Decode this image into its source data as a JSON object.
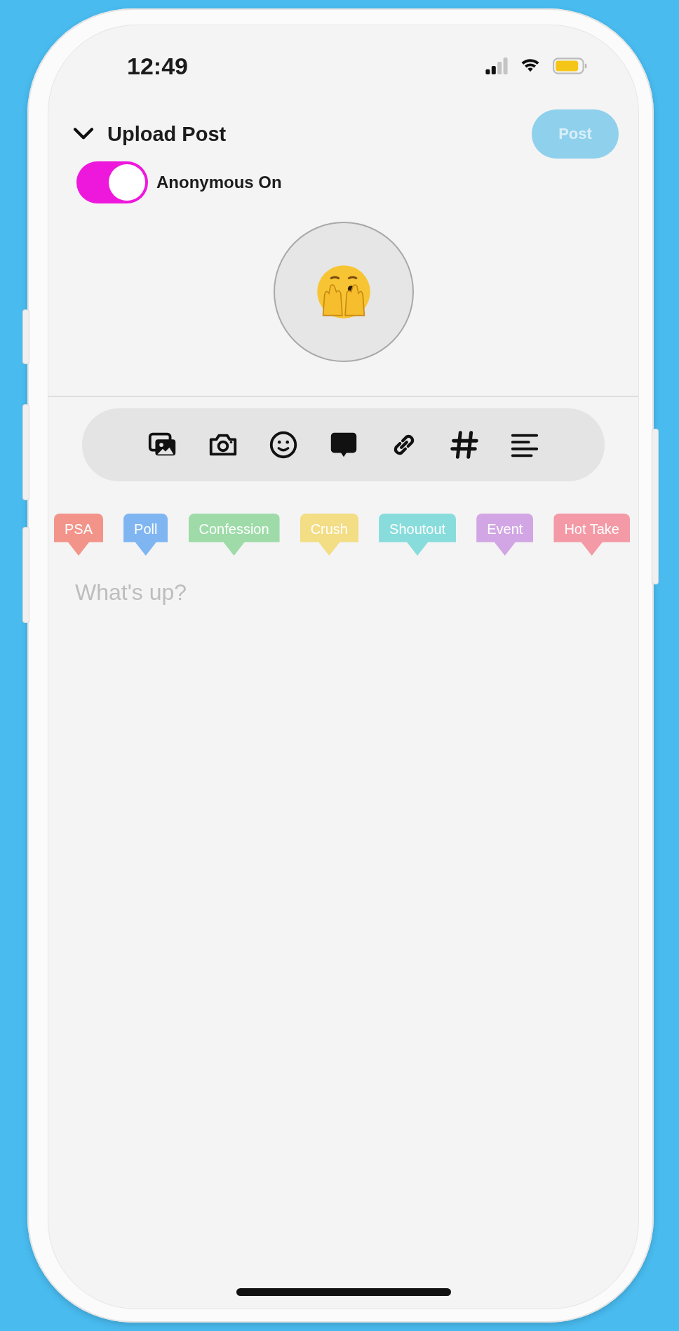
{
  "status_bar": {
    "time": "12:49"
  },
  "header": {
    "title": "Upload Post",
    "post_button": {
      "label": "Post",
      "disabled": true
    }
  },
  "anonymous_toggle": {
    "label": "Anonymous On",
    "on": true
  },
  "tags": [
    {
      "label": "PSA",
      "color": "#f2948a"
    },
    {
      "label": "Poll",
      "color": "#7fb6f2"
    },
    {
      "label": "Confession",
      "color": "#9edba8"
    },
    {
      "label": "Crush",
      "color": "#f3dd85"
    },
    {
      "label": "Shoutout",
      "color": "#88dcdc"
    },
    {
      "label": "Event",
      "color": "#d2a6e4"
    },
    {
      "label": "Hot Take",
      "color": "#f39aa6"
    }
  ],
  "composer": {
    "placeholder": "What's up?"
  }
}
